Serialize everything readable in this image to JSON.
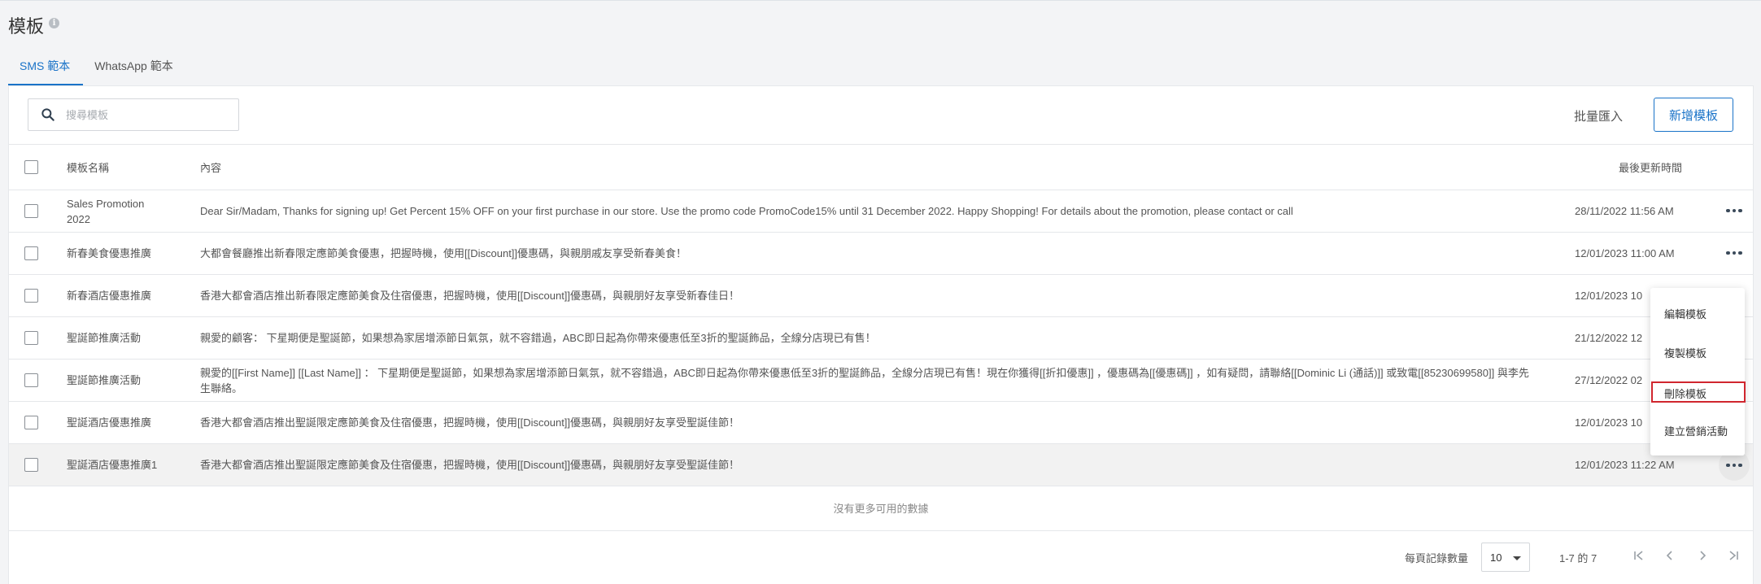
{
  "page": {
    "title": "模板"
  },
  "tabs": [
    {
      "label": "SMS 範本",
      "active": true
    },
    {
      "label": "WhatsApp 範本",
      "active": false
    }
  ],
  "toolbar": {
    "search_placeholder": "搜尋模板",
    "batch_import_label": "批量匯入",
    "add_template_label": "新增模板"
  },
  "table": {
    "headers": {
      "name": "模板名稱",
      "content": "內容",
      "updated": "最後更新時間"
    },
    "rows": [
      {
        "name": "Sales Promotion 2022",
        "content": "Dear Sir/Madam, Thanks for signing up! Get Percent 15% OFF on your first purchase in our store. Use the promo code PromoCode15% until 31 December 2022. Happy Shopping! For details about the promotion, please contact or call",
        "updated": "28/11/2022 11:56 AM"
      },
      {
        "name": "新春美食優惠推廣",
        "content": "大都會餐廳推出新春限定應節美食優惠，把握時機，使用[[Discount]]優惠碼，與親朋戚友享受新春美食！",
        "updated": "12/01/2023 11:00 AM"
      },
      {
        "name": "新春酒店優惠推廣",
        "content": "香港大都會酒店推出新春限定應節美食及住宿優惠，把握時機，使用[[Discount]]優惠碼，與親朋好友享受新春佳日！",
        "updated": "12/01/2023 10"
      },
      {
        "name": "聖誕節推廣活動",
        "content": "親愛的顧客： 下星期便是聖誕節，如果想為家居增添節日氣氛，就不容錯過，ABC即日起為你帶來優惠低至3折的聖誕飾品，全線分店現已有售！",
        "updated": "21/12/2022 12"
      },
      {
        "name": "聖誕節推廣活動",
        "content": "親愛的[[First Name]] [[Last Name]] ： 下星期便是聖誕節，如果想為家居增添節日氣氛，就不容錯過，ABC即日起為你帶來優惠低至3折的聖誕飾品，全線分店現已有售！現在你獲得[[折扣優惠]] ，優惠碼為[[優惠碼]] ，如有疑問，請聯絡[[Dominic Li (通話)]] 或致電[[85230699580]] 與李先生聯絡。",
        "updated": "27/12/2022 02"
      },
      {
        "name": "聖誕酒店優惠推廣",
        "content": "香港大都會酒店推出聖誕限定應節美食及住宿優惠，把握時機，使用[[Discount]]優惠碼，與親朋好友享受聖誕佳節！",
        "updated": "12/01/2023 10"
      },
      {
        "name": "聖誕酒店優惠推廣1",
        "content": "香港大都會酒店推出聖誕限定應節美食及住宿優惠，把握時機，使用[[Discount]]優惠碼，與親朋好友享受聖誕佳節！",
        "updated": "12/01/2023 11:22 AM"
      }
    ],
    "no_more_text": "沒有更多可用的數據"
  },
  "pagination": {
    "rows_per_page_label": "每頁記錄數量",
    "rows_per_page_value": "10",
    "range_text": "1-7 的 7"
  },
  "context_menu": {
    "items": [
      "編輯模板",
      "複製模板",
      "刪除模板",
      "建立營銷活動"
    ]
  },
  "colors": {
    "accent": "#1a73c8",
    "highlight_border": "#d0262e"
  }
}
